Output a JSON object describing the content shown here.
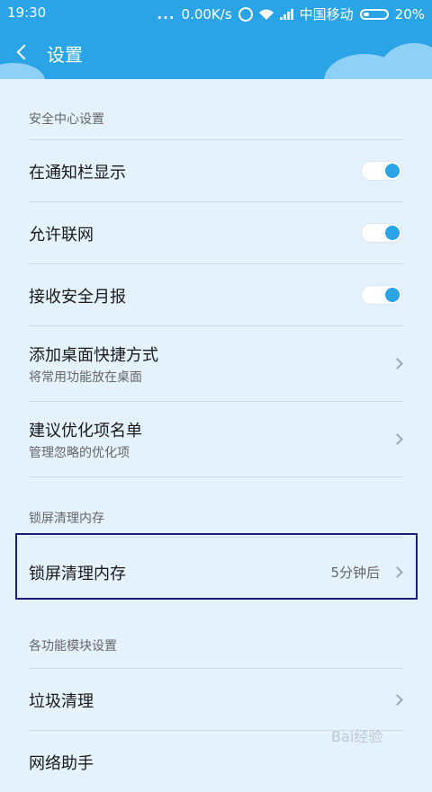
{
  "status_bar": {
    "time": "19:30",
    "network_speed": "0.00K/s",
    "carrier": "中国移动",
    "battery": "20%",
    "icons": [
      "alarm-icon",
      "wifi-icon",
      "signal-icon",
      "battery-icon"
    ]
  },
  "header": {
    "title": "设置",
    "back_icon": "chevron-left-icon",
    "color": "#2aa4e6"
  },
  "sections": [
    {
      "title": "安全中心设置",
      "items": [
        {
          "label": "在通知栏显示",
          "toggle": true
        },
        {
          "label": "允许联网",
          "toggle": true
        },
        {
          "label": "接收安全月报",
          "toggle": true
        },
        {
          "label": "添加桌面快捷方式",
          "subtitle": "将常用功能放在桌面"
        },
        {
          "label": "建议优化项名单",
          "subtitle": "管理忽略的优化项"
        }
      ]
    },
    {
      "title": "锁屏清理内存",
      "items": [
        {
          "label": "锁屏清理内存",
          "value": "5分钟后",
          "highlighted": true
        }
      ]
    },
    {
      "title": "各功能模块设置",
      "items": [
        {
          "label": "垃圾清理"
        },
        {
          "label": "网络助手"
        }
      ]
    }
  ],
  "watermark": "Bai经验"
}
